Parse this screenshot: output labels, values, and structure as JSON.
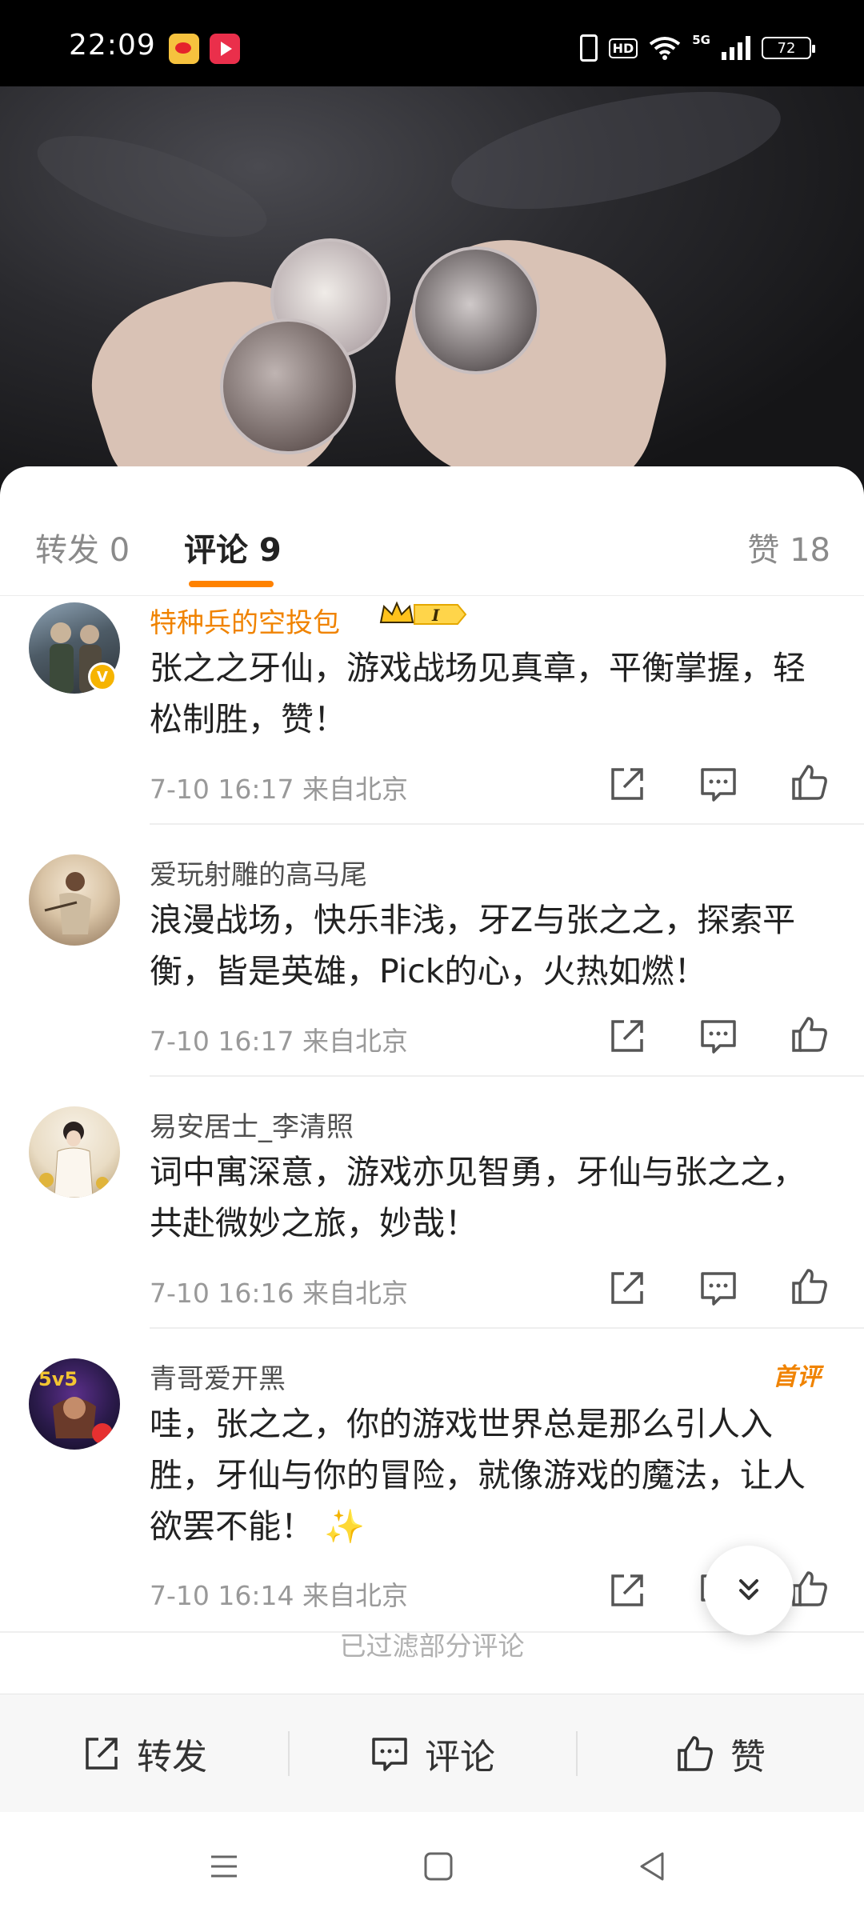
{
  "status_bar": {
    "time": "22:09",
    "network": "5G",
    "battery": "72"
  },
  "video": {
    "caption": ""
  },
  "tabs": {
    "repost": "转发 0",
    "comments": "评论 9",
    "likes": "赞 18"
  },
  "comments": [
    {
      "username": "特种兵的空投包",
      "text": "张之之牙仙，游戏战场见真章，平衡掌握，轻松制胜，赞！",
      "meta": "7-10 16:17 来自北京"
    },
    {
      "username": "爱玩射雕的高马尾",
      "text": "浪漫战场，快乐非浅，牙Z与张之之，探索平衡，皆是英雄，Pick的心，火热如燃！",
      "meta": "7-10 16:17 来自北京"
    },
    {
      "username": "易安居士_李清照",
      "text": "词中寓深意，游戏亦见智勇，牙仙与张之之，共赴微妙之旅，妙哉！",
      "meta": "7-10 16:16 来自北京"
    },
    {
      "username": "青哥爱开黑",
      "badge": "首评",
      "text": "哇，张之之，你的游戏世界总是那么引人入胜，牙仙与你的冒险，就像游戏的魔法，让人欲罢不能！ ✨",
      "meta": "7-10 16:14 来自北京"
    }
  ],
  "filtered_note": "已过滤部分评论",
  "bottom_bar": {
    "repost": "转发",
    "comment": "评论",
    "like": "赞"
  },
  "colors": {
    "accent": "#ff8200",
    "vip_name": "#f08300"
  }
}
